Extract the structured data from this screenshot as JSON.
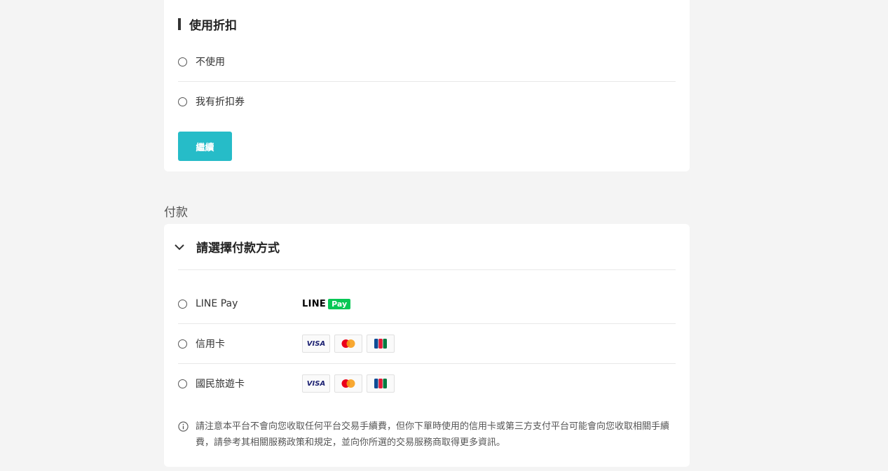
{
  "discount": {
    "title": "使用折扣",
    "options": [
      {
        "label": "不使用"
      },
      {
        "label": "我有折扣券"
      }
    ],
    "continue_label": "繼續"
  },
  "payment": {
    "section_label": "付款",
    "header": "請選擇付款方式",
    "methods": [
      {
        "label": "LINE Pay",
        "logos": [
          "LINE Pay"
        ]
      },
      {
        "label": "信用卡",
        "logos": [
          "VISA",
          "Mastercard",
          "JCB"
        ]
      },
      {
        "label": "國民旅遊卡",
        "logos": [
          "VISA",
          "Mastercard",
          "JCB"
        ]
      }
    ],
    "line_logo": {
      "line": "LINE",
      "pay": "Pay"
    },
    "visa_text": "VISA",
    "notice": "請注意本平台不會向您收取任何平台交易手續費，但你下單時使用的信用卡或第三方支付平台可能會向您收取相關手續費，請參考其相關服務政策和規定，並向你所選的交易服務商取得更多資訊。"
  },
  "colors": {
    "accent": "#26bcc8",
    "line_green": "#06c755",
    "page_bg": "#f4f4f4",
    "card_bg": "#ffffff"
  },
  "icons": [
    "chevron-down-icon",
    "info-icon",
    "line-pay-logo",
    "visa-logo",
    "mastercard-logo",
    "jcb-logo"
  ]
}
